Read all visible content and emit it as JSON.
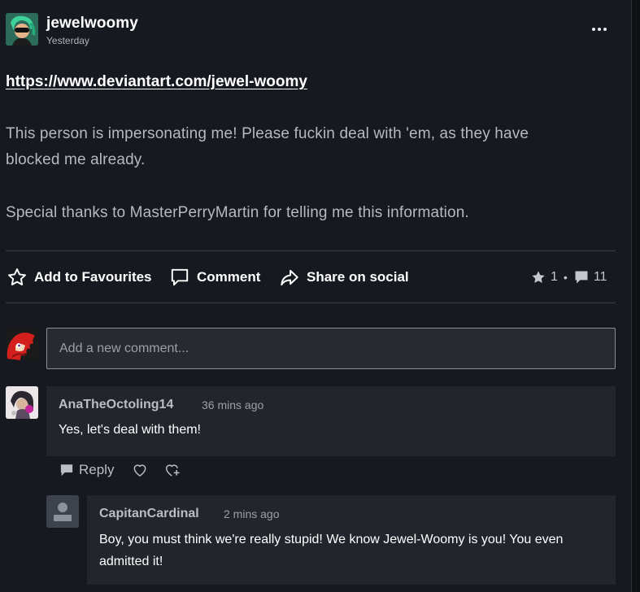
{
  "post": {
    "author": "jewelwoomy",
    "time": "Yesterday",
    "link": "https://www.deviantart.com/jewel-woomy",
    "text_line1": "This person is impersonating me! Please fuckin deal with 'em, as they have",
    "text_line2": "blocked me already.",
    "text_line3": "Special thanks to MasterPerryMartin for telling me this information."
  },
  "actions": {
    "favourite_label": "Add to Favourites",
    "comment_label": "Comment",
    "share_label": "Share on social",
    "favourites_count": "1",
    "separator": "•",
    "comments_count": "11"
  },
  "new_comment": {
    "placeholder": "Add a new comment..."
  },
  "comments": [
    {
      "author": "AnaTheOctoling14",
      "time": "36 mins ago",
      "text": "Yes, let's deal with them!",
      "reply_label": "Reply"
    },
    {
      "author": "CapitanCardinal",
      "time": "2 mins ago",
      "text": "Boy, you must think we're really stupid! We know Jewel-Woomy is you! You even admitted it!"
    }
  ],
  "icons": {
    "more": "more-horizontal-icon",
    "favourite": "star-outline-icon",
    "comment": "speech-bubble-icon",
    "share": "share-arrow-icon",
    "fav_count": "star-filled-icon",
    "comment_count": "speech-bubble-filled-icon",
    "reply": "reply-bubble-icon",
    "like": "heart-outline-icon",
    "award": "award-heart-icon",
    "default_avatar": "person-silhouette-icon"
  },
  "colors": {
    "background": "#16191f",
    "comment_box": "#22252c",
    "input_background": "#272a31",
    "divider": "#3a3f48"
  }
}
